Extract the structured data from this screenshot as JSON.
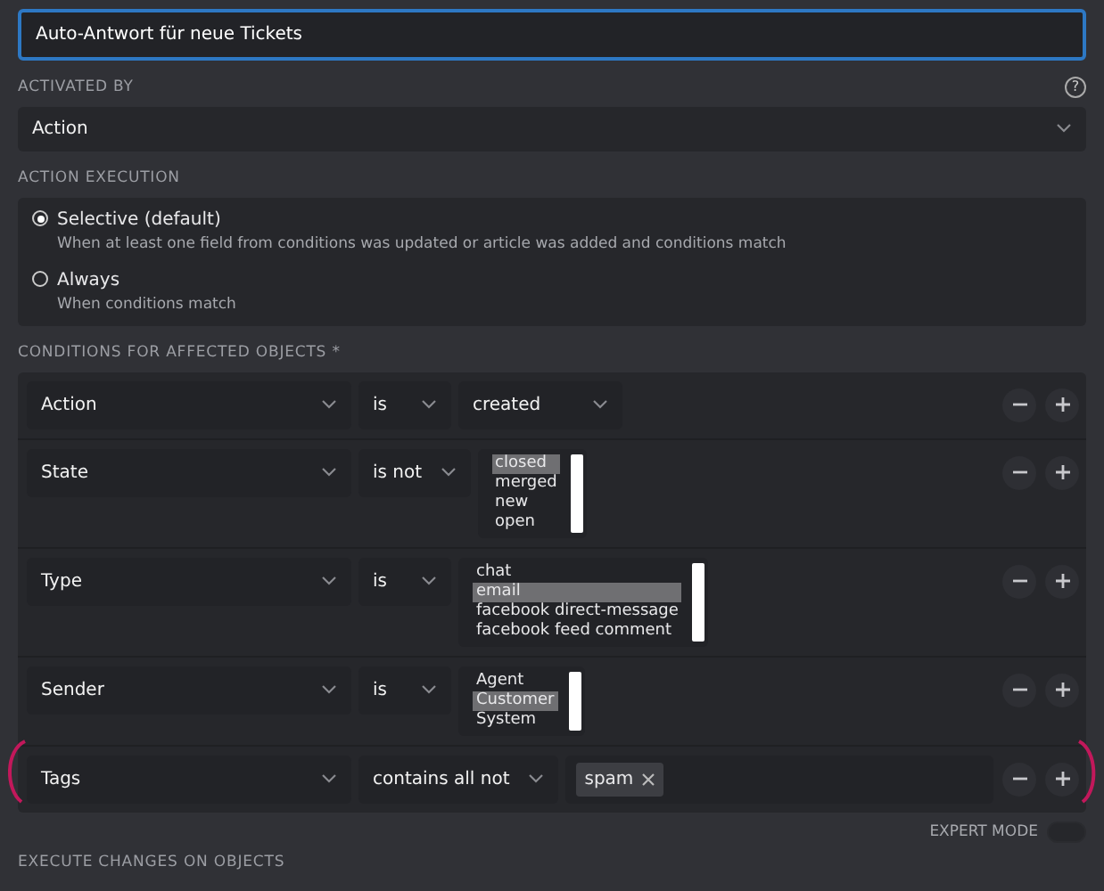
{
  "title_field": {
    "value": "Auto-Antwort für neue Tickets",
    "focused": true
  },
  "activated_by": {
    "label": "ACTIVATED BY",
    "help": "?",
    "value": "Action"
  },
  "action_execution": {
    "label": "ACTION EXECUTION",
    "options": [
      {
        "label": "Selective (default)",
        "description": "When at least one field from conditions was updated or article was added and conditions match",
        "selected": true
      },
      {
        "label": "Always",
        "description": "When conditions match",
        "selected": false
      }
    ]
  },
  "conditions": {
    "label": "CONDITIONS FOR AFFECTED OBJECTS *",
    "rows": [
      {
        "attribute": "Action",
        "operator": "is",
        "kind": "select",
        "value": "created",
        "highlighted": false
      },
      {
        "attribute": "State",
        "operator": "is not",
        "kind": "listbox",
        "options": [
          {
            "label": "closed",
            "selected": true
          },
          {
            "label": "merged",
            "selected": false
          },
          {
            "label": "new",
            "selected": false
          },
          {
            "label": "open",
            "selected": false
          }
        ],
        "highlighted": false
      },
      {
        "attribute": "Type",
        "operator": "is",
        "kind": "listbox",
        "options": [
          {
            "label": "chat",
            "selected": false
          },
          {
            "label": "email",
            "selected": true
          },
          {
            "label": "facebook direct-message",
            "selected": false
          },
          {
            "label": "facebook feed comment",
            "selected": false
          }
        ],
        "highlighted": false
      },
      {
        "attribute": "Sender",
        "operator": "is",
        "kind": "listbox",
        "options": [
          {
            "label": "Agent",
            "selected": false
          },
          {
            "label": "Customer",
            "selected": true
          },
          {
            "label": "System",
            "selected": false
          }
        ],
        "highlighted": false
      },
      {
        "attribute": "Tags",
        "operator": "contains all not",
        "kind": "tags",
        "tags": [
          "spam"
        ],
        "highlighted": true
      }
    ]
  },
  "expert_mode": {
    "label": "EXPERT MODE",
    "on": false
  },
  "next_section": {
    "label": "EXECUTE CHANGES ON OBJECTS"
  }
}
